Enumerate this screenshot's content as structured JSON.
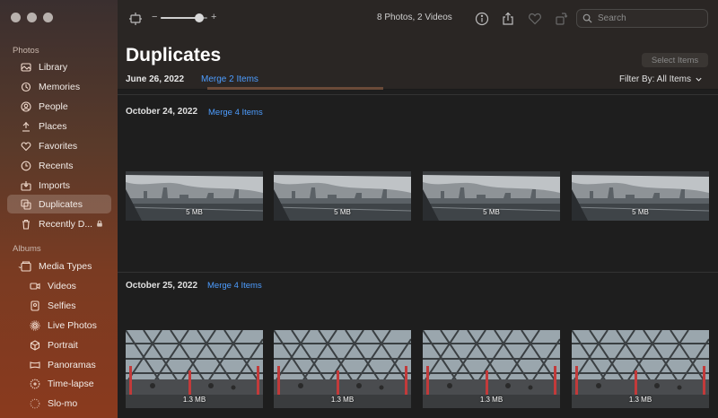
{
  "sidebar": {
    "section_photos": "Photos",
    "section_albums": "Albums",
    "items": [
      {
        "label": "Library",
        "icon": "library-icon"
      },
      {
        "label": "Memories",
        "icon": "memories-icon"
      },
      {
        "label": "People",
        "icon": "people-icon"
      },
      {
        "label": "Places",
        "icon": "places-icon"
      },
      {
        "label": "Favorites",
        "icon": "heart-icon"
      },
      {
        "label": "Recents",
        "icon": "clock-icon"
      },
      {
        "label": "Imports",
        "icon": "import-icon"
      },
      {
        "label": "Duplicates",
        "icon": "duplicates-icon",
        "selected": true
      },
      {
        "label": "Recently D...",
        "icon": "trash-icon",
        "locked": true
      }
    ],
    "media_types_label": "Media Types",
    "media_types": [
      {
        "label": "Videos",
        "icon": "video-icon"
      },
      {
        "label": "Selfies",
        "icon": "selfie-icon"
      },
      {
        "label": "Live Photos",
        "icon": "live-photo-icon"
      },
      {
        "label": "Portrait",
        "icon": "portrait-icon"
      },
      {
        "label": "Panoramas",
        "icon": "panorama-icon"
      },
      {
        "label": "Time-lapse",
        "icon": "timelapse-icon"
      },
      {
        "label": "Slo-mo",
        "icon": "slomo-icon"
      }
    ]
  },
  "toolbar": {
    "zoom_minus": "−",
    "zoom_plus": "+",
    "zoom_level": 0.82,
    "count_text": "8 Photos, 2 Videos",
    "search_placeholder": "Search"
  },
  "header": {
    "title": "Duplicates",
    "select_items": "Select Items",
    "date": "June 26, 2022",
    "merge": "Merge 2 Items",
    "filter": "Filter By: All Items"
  },
  "groups": [
    {
      "date": "October 24, 2022",
      "merge": "Merge 4 Items",
      "photos": [
        "5 MB",
        "5 MB",
        "5 MB",
        "5 MB"
      ]
    },
    {
      "date": "October 25, 2022",
      "merge": "Merge 4 Items",
      "photos": [
        "1.3 MB",
        "1.3 MB",
        "1.3 MB",
        "1.3 MB"
      ]
    }
  ],
  "colors": {
    "accent": "#4d9dff",
    "selected_row": "#ffffff2e"
  }
}
